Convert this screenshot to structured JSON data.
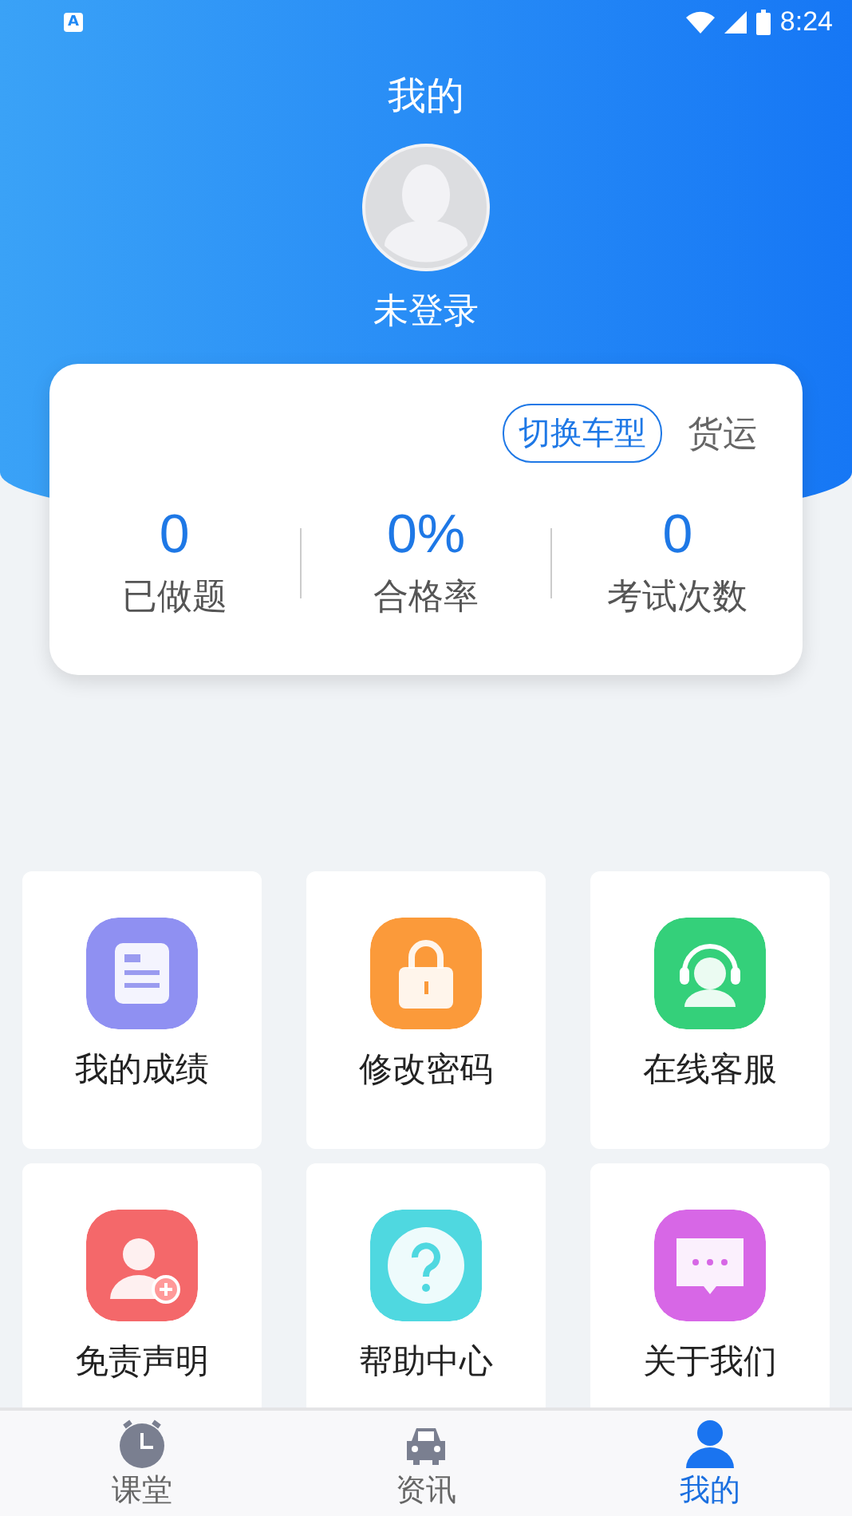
{
  "status_bar": {
    "notification": "A",
    "time": "8:24"
  },
  "header": {
    "title": "我的",
    "user": "未登录"
  },
  "stats_card": {
    "switch_button": "切换车型",
    "vehicle_type": "货运",
    "stats": [
      {
        "value": "0",
        "label": "已做题"
      },
      {
        "value": "0%",
        "label": "合格率"
      },
      {
        "value": "0",
        "label": "考试次数"
      }
    ]
  },
  "menu": [
    {
      "label": "我的成绩",
      "kind": "report",
      "color": "#8f90f2"
    },
    {
      "label": "修改密码",
      "kind": "lock",
      "color": "#fb9a3a"
    },
    {
      "label": "在线客服",
      "kind": "service",
      "color": "#34d07a"
    },
    {
      "label": "免责声明",
      "kind": "disclaimer",
      "color": "#f4686a"
    },
    {
      "label": "帮助中心",
      "kind": "help",
      "color": "#4fd8e0"
    },
    {
      "label": "关于我们",
      "kind": "about",
      "color": "#d767e6"
    }
  ],
  "tabs": [
    {
      "label": "课堂",
      "kind": "classroom",
      "selected": false
    },
    {
      "label": "资讯",
      "kind": "news",
      "selected": false
    },
    {
      "label": "我的",
      "kind": "profile",
      "selected": true
    }
  ]
}
